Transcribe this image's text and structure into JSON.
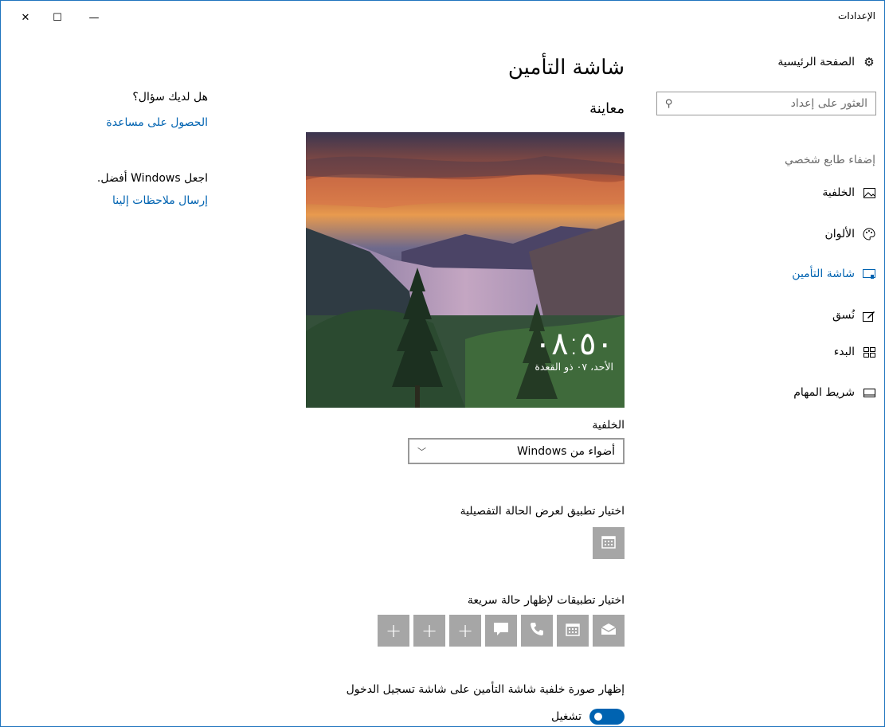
{
  "window": {
    "title": "الإعدادات",
    "close_glyph": "✕",
    "maximize_glyph": "☐",
    "minimize_glyph": "—"
  },
  "sidebar": {
    "home_label": "الصفحة الرئيسية",
    "search_placeholder": "العثور على إعداد",
    "section_title": "إضفاء طابع شخصي",
    "items": [
      {
        "label": "الخلفية",
        "icon": "picture-icon"
      },
      {
        "label": "الألوان",
        "icon": "palette-icon"
      },
      {
        "label": "شاشة التأمين",
        "icon": "lock-screen-icon",
        "active": true
      },
      {
        "label": "نُسق",
        "icon": "brush-icon"
      },
      {
        "label": "البدء",
        "icon": "start-tiles-icon"
      },
      {
        "label": "شريط المهام",
        "icon": "taskbar-icon"
      }
    ]
  },
  "main": {
    "page_title": "شاشة التأمين",
    "preview_heading": "معاينة",
    "preview_time": "٠٨:٥٠",
    "preview_date": "الأحد، ٠٧ ذو القعدة",
    "background_label": "الخلفية",
    "background_value": "أضواء من Windows",
    "detailed_status_label": "اختيار تطبيق لعرض الحالة التفصيلية",
    "quick_status_label": "اختيار تطبيقات لإظهار حالة سريعة",
    "quick_tiles": [
      "mail-icon",
      "calendar-icon",
      "phone-icon",
      "message-icon",
      "plus-icon",
      "plus-icon",
      "plus-icon"
    ],
    "signin_bg_label": "إظهار صورة خلفية شاشة التأمين على شاشة تسجيل الدخول",
    "toggle_state": "تشغيل"
  },
  "help": {
    "question": "هل لديك سؤال؟",
    "get_help": "الحصول على مساعدة",
    "improve": "اجعل Windows أفضل.",
    "feedback": "إرسال ملاحظات إلينا"
  },
  "colors": {
    "accent": "#0063b1",
    "tile": "#a6a6a6"
  }
}
